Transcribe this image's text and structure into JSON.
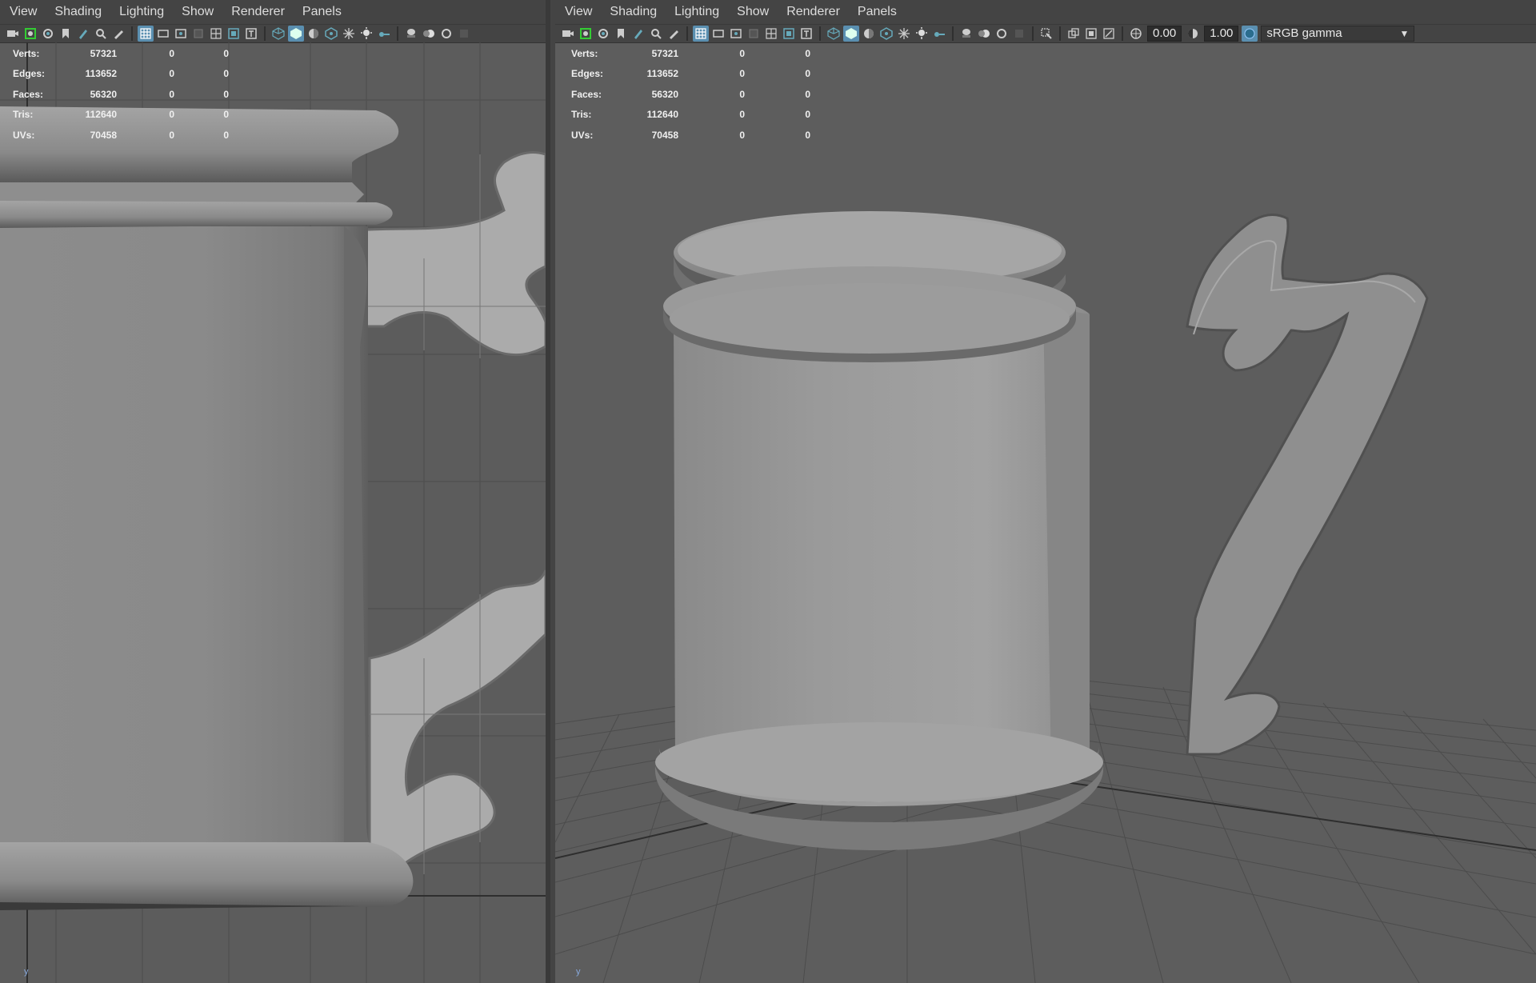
{
  "menu": [
    "View",
    "Shading",
    "Lighting",
    "Show",
    "Renderer",
    "Panels"
  ],
  "hud": {
    "rows": [
      {
        "label": "Verts:",
        "values": [
          "57321",
          "0",
          "0"
        ]
      },
      {
        "label": "Edges:",
        "values": [
          "113652",
          "0",
          "0"
        ]
      },
      {
        "label": "Faces:",
        "values": [
          "56320",
          "0",
          "0"
        ]
      },
      {
        "label": "Tris:",
        "values": [
          "112640",
          "0",
          "0"
        ]
      },
      {
        "label": "UVs:",
        "values": [
          "70458",
          "0",
          "0"
        ]
      }
    ]
  },
  "right_toolbar": {
    "exposure": "0.00",
    "gamma": "1.00",
    "colorspace": "sRGB gamma"
  },
  "axis": {
    "y": "y"
  },
  "colors": {
    "accent": "#5a8fb0",
    "viewport_bg": "#5d5d5d",
    "menubar_bg": "#444444"
  },
  "icons": [
    "camera-icon",
    "camera-attributes-icon",
    "bookmark-icon",
    "image-plane-icon",
    "grid-icon",
    "film-gate-icon",
    "resolution-gate-icon",
    "safe-action-icon",
    "wireframe-icon",
    "smooth-shade-icon",
    "texture-icon",
    "lights-icon",
    "shadows-icon",
    "ambient-occlusion-icon",
    "xray-icon",
    "isolate-select-icon",
    "exposure-icon",
    "gamma-icon",
    "color-management-icon"
  ]
}
